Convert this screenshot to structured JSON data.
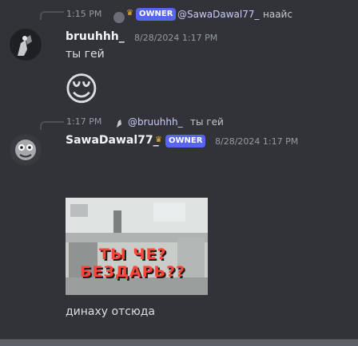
{
  "reply1": {
    "timestamp": "1:15 PM",
    "badge": "OWNER",
    "mention": "@SawaDawal77_",
    "text": "наайс"
  },
  "message1": {
    "username": "bruuhhh_",
    "timestamp": "8/28/2024 1:17 PM",
    "text": "ты гей",
    "emoji": "😌"
  },
  "reply2": {
    "timestamp": "1:17 PM",
    "mention": "@bruuhhh_",
    "text": "ты гей"
  },
  "message2": {
    "username": "SawaDawal77_",
    "badge": "OWNER",
    "timestamp": "8/28/2024 1:17 PM",
    "meme_line1": "ТЫ ЧЕ?",
    "meme_line2": "БЕЗДАРЬ??",
    "text": "динаху отсюда"
  },
  "colors": {
    "background": "#313338",
    "badge": "#5865f2",
    "crown": "#f0b232",
    "meme_text": "#ff4438"
  }
}
